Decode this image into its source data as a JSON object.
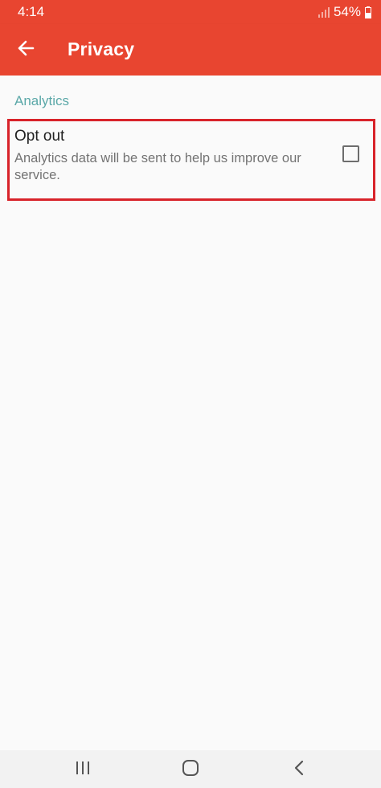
{
  "status_bar": {
    "time": "4:14",
    "battery": "54%",
    "icons": [
      "signal-icon",
      "battery-icon"
    ]
  },
  "app_bar": {
    "title": "Privacy",
    "back_icon": "arrow-back-icon",
    "background_color": "#e84530"
  },
  "settings": {
    "section_header": "Analytics",
    "section_header_color": "#5ba8a8",
    "items": [
      {
        "title": "Opt out",
        "summary": "Analytics data will be sent to help us improve our service.",
        "checked": false
      }
    ],
    "highlight_color": "#d8232a"
  },
  "nav_bar": {
    "buttons": [
      "recents-icon",
      "home-icon",
      "back-icon"
    ]
  }
}
